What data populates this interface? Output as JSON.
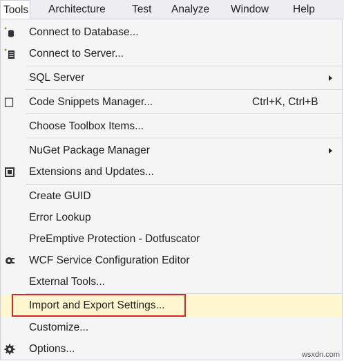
{
  "menubar": {
    "items": [
      {
        "label": "Tools",
        "active": true
      },
      {
        "label": "Architecture"
      },
      {
        "label": "Test"
      },
      {
        "label": "Analyze"
      },
      {
        "label": "Window"
      },
      {
        "label": "Help"
      }
    ]
  },
  "menu": {
    "items": [
      {
        "label": "Connect to Database...",
        "icon": "database-connect-icon"
      },
      {
        "label": "Connect to Server...",
        "icon": "server-connect-icon"
      },
      {
        "label": "SQL Server",
        "submenu": true
      },
      {
        "label": "Code Snippets Manager...",
        "shortcut": "Ctrl+K, Ctrl+B",
        "icon": "snippet-icon"
      },
      {
        "label": "Choose Toolbox Items..."
      },
      {
        "label": "NuGet Package Manager",
        "submenu": true
      },
      {
        "label": "Extensions and Updates...",
        "icon": "extensions-icon"
      },
      {
        "label": "Create GUID"
      },
      {
        "label": "Error Lookup"
      },
      {
        "label": "PreEmptive Protection - Dotfuscator"
      },
      {
        "label": "WCF Service Configuration Editor",
        "icon": "wcf-config-icon"
      },
      {
        "label": "External Tools..."
      },
      {
        "label": "Import and Export Settings...",
        "highlighted": true
      },
      {
        "label": "Customize..."
      },
      {
        "label": "Options...",
        "icon": "gear-icon"
      }
    ]
  },
  "watermark": "wsxdn.com",
  "colors": {
    "menubar_bg": "#eeeef2",
    "menu_bg": "#f5f5f5",
    "highlight_bg": "#fdf6cf",
    "highlight_border": "#d9252a"
  }
}
